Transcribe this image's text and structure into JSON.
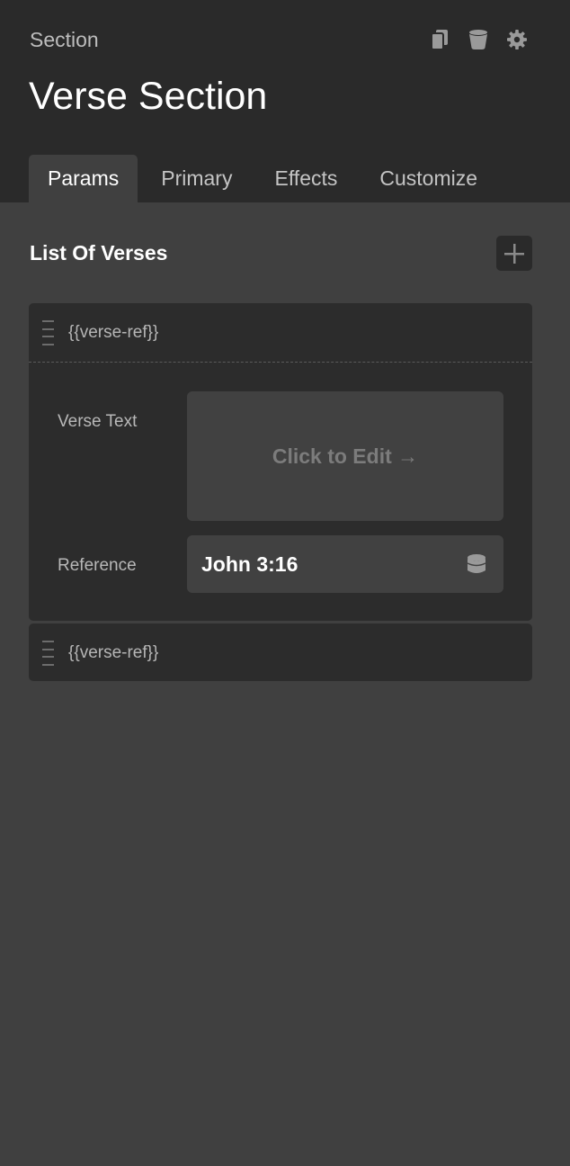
{
  "header": {
    "kind": "Section",
    "title": "Verse Section",
    "actions": [
      {
        "icon": "copy-icon"
      },
      {
        "icon": "trash-icon"
      },
      {
        "icon": "gear-icon"
      }
    ]
  },
  "tabs": [
    {
      "label": "Params",
      "active": true
    },
    {
      "label": "Primary",
      "active": false
    },
    {
      "label": "Effects",
      "active": false
    },
    {
      "label": "Customize",
      "active": false
    }
  ],
  "list": {
    "title": "List Of Verses",
    "add_icon": "plus-icon",
    "items": [
      {
        "label": "{{verse-ref}}",
        "expanded": true,
        "fields": {
          "verse_text_label": "Verse Text",
          "verse_text_placeholder": "Click to Edit →",
          "reference_label": "Reference",
          "reference_value": "John 3:16",
          "reference_icon": "database-icon"
        }
      },
      {
        "label": "{{verse-ref}}",
        "expanded": false
      }
    ]
  },
  "colors": {
    "header_bg": "#2a2a2a",
    "panel_bg": "#404040",
    "item_bg": "#2c2c2c",
    "input_bg": "#414141",
    "text_primary": "#ffffff",
    "text_secondary": "#b8b8b8"
  }
}
